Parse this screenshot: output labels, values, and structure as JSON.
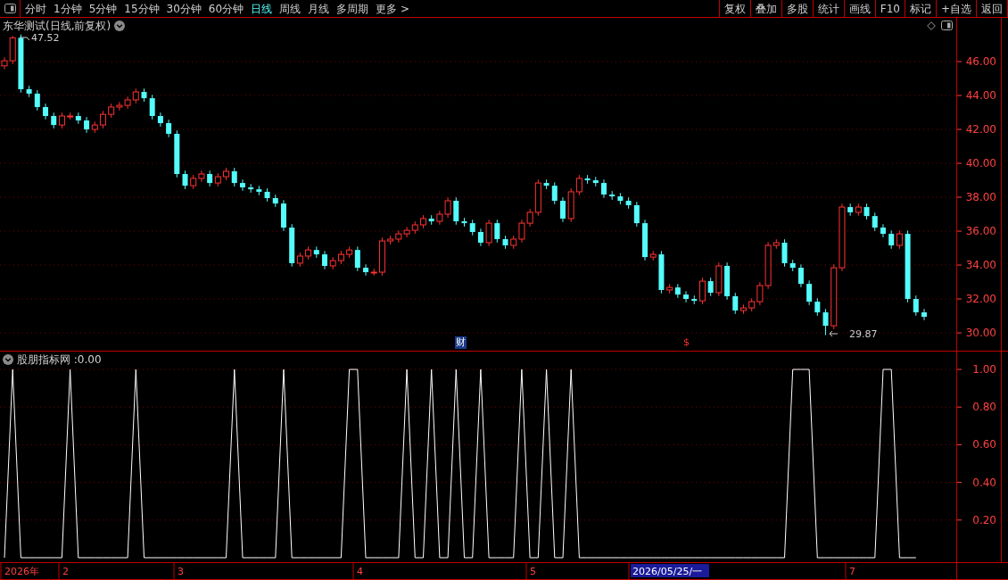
{
  "toolbar": {
    "tabs": [
      {
        "label": "分时",
        "selected": false
      },
      {
        "label": "1分钟",
        "selected": false
      },
      {
        "label": "5分钟",
        "selected": false
      },
      {
        "label": "15分钟",
        "selected": false
      },
      {
        "label": "30分钟",
        "selected": false
      },
      {
        "label": "60分钟",
        "selected": false
      },
      {
        "label": "日线",
        "selected": true
      },
      {
        "label": "周线",
        "selected": false
      },
      {
        "label": "月线",
        "selected": false
      },
      {
        "label": "多周期",
        "selected": false
      },
      {
        "label": "更多 >",
        "selected": false
      }
    ],
    "buttons": [
      "复权",
      "叠加",
      "多股",
      "统计",
      "画线",
      "F10",
      "标记",
      "+自选",
      "返回"
    ]
  },
  "price_pane": {
    "title": "东华测试(日线,前复权)",
    "chart_data": {
      "type": "candlestick",
      "grid": true,
      "ylim": [
        28.95,
        48.58
      ],
      "yticks": [
        {
          "value": 30,
          "label": "30.00"
        },
        {
          "value": 32,
          "label": "32.00"
        },
        {
          "value": 34,
          "label": "34.00"
        },
        {
          "value": 36,
          "label": "36.00"
        },
        {
          "value": 38,
          "label": "38.00"
        },
        {
          "value": 40,
          "label": "40.00"
        },
        {
          "value": 42,
          "label": "42.00"
        },
        {
          "value": 44,
          "label": "44.00"
        },
        {
          "value": 46,
          "label": "46.00"
        }
      ],
      "categories": [
        null,
        null,
        null,
        null,
        null,
        null,
        null,
        null,
        null,
        null,
        null,
        null,
        null,
        null,
        null,
        null,
        null,
        null,
        null,
        null,
        null,
        null,
        null,
        null,
        null,
        null,
        null,
        null,
        null,
        null,
        null,
        null,
        null,
        null,
        null,
        null,
        null,
        null,
        null,
        null,
        null,
        null,
        null,
        null,
        null,
        null,
        null,
        null,
        null,
        null,
        null,
        null,
        null,
        null,
        null,
        null,
        null,
        null,
        null,
        null,
        null,
        null,
        null,
        null,
        null,
        null,
        null,
        null,
        null,
        null,
        null,
        null,
        null,
        null,
        null,
        null,
        null,
        null,
        null,
        null,
        null,
        null,
        null,
        null,
        null,
        null,
        null,
        null,
        null,
        null,
        null,
        null,
        null,
        null,
        null,
        null,
        null,
        null,
        null,
        null,
        null,
        null,
        null,
        null,
        null,
        null,
        null,
        null,
        null,
        null,
        null,
        null,
        null
      ],
      "ohlc": [
        [
          45.75,
          46.25,
          45.55,
          46.05
        ],
        [
          46.05,
          47.52,
          45.85,
          47.4
        ],
        [
          47.4,
          47.6,
          44.17,
          44.37
        ],
        [
          44.37,
          44.57,
          43.91,
          44.11
        ],
        [
          44.11,
          44.31,
          43.12,
          43.32
        ],
        [
          43.32,
          43.52,
          42.59,
          42.79
        ],
        [
          42.79,
          42.99,
          42.06,
          42.26
        ],
        [
          42.26,
          42.99,
          42.06,
          42.79
        ],
        [
          42.79,
          42.99,
          42.59,
          42.79
        ],
        [
          42.79,
          42.99,
          42.33,
          42.53
        ],
        [
          42.53,
          42.73,
          41.8,
          42.0
        ],
        [
          42.0,
          42.46,
          41.8,
          42.26
        ],
        [
          42.26,
          43.09,
          42.06,
          42.89
        ],
        [
          42.89,
          43.52,
          42.69,
          43.32
        ],
        [
          43.32,
          43.62,
          43.12,
          43.42
        ],
        [
          43.42,
          43.94,
          43.22,
          43.74
        ],
        [
          43.74,
          44.41,
          43.54,
          44.21
        ],
        [
          44.21,
          44.41,
          43.64,
          43.84
        ],
        [
          43.84,
          44.04,
          42.59,
          42.79
        ],
        [
          42.79,
          42.99,
          42.17,
          42.37
        ],
        [
          42.37,
          42.57,
          41.54,
          41.74
        ],
        [
          41.74,
          41.94,
          39.17,
          39.37
        ],
        [
          39.37,
          39.57,
          38.48,
          38.68
        ],
        [
          38.68,
          39.31,
          38.48,
          39.11
        ],
        [
          39.11,
          39.57,
          38.91,
          39.37
        ],
        [
          39.37,
          39.57,
          38.64,
          38.84
        ],
        [
          38.84,
          39.41,
          38.64,
          39.21
        ],
        [
          39.21,
          39.73,
          39.01,
          39.53
        ],
        [
          39.53,
          39.73,
          38.64,
          38.84
        ],
        [
          38.84,
          39.04,
          38.38,
          38.58
        ],
        [
          38.58,
          38.78,
          38.27,
          38.47
        ],
        [
          38.47,
          38.67,
          38.12,
          38.32
        ],
        [
          38.32,
          38.52,
          37.75,
          37.95
        ],
        [
          37.95,
          38.15,
          37.43,
          37.63
        ],
        [
          37.63,
          37.83,
          36.01,
          36.21
        ],
        [
          36.21,
          36.41,
          33.91,
          34.11
        ],
        [
          34.11,
          34.73,
          33.91,
          34.53
        ],
        [
          34.53,
          35.09,
          34.33,
          34.89
        ],
        [
          34.89,
          35.09,
          34.43,
          34.63
        ],
        [
          34.63,
          34.83,
          33.75,
          33.95
        ],
        [
          33.95,
          34.46,
          33.75,
          34.26
        ],
        [
          34.26,
          34.83,
          34.06,
          34.63
        ],
        [
          34.63,
          35.09,
          34.43,
          34.89
        ],
        [
          34.89,
          35.09,
          33.64,
          33.84
        ],
        [
          33.84,
          34.04,
          33.38,
          33.58
        ],
        [
          33.58,
          33.78,
          33.38,
          33.58
        ],
        [
          33.58,
          35.62,
          33.38,
          35.42
        ],
        [
          35.42,
          35.73,
          35.22,
          35.53
        ],
        [
          35.53,
          36.04,
          35.33,
          35.84
        ],
        [
          35.84,
          36.25,
          35.64,
          36.05
        ],
        [
          36.05,
          36.57,
          35.85,
          36.37
        ],
        [
          36.37,
          36.94,
          36.17,
          36.74
        ],
        [
          36.74,
          36.94,
          36.38,
          36.58
        ],
        [
          36.58,
          37.2,
          36.38,
          37.0
        ],
        [
          37.0,
          37.99,
          36.8,
          37.79
        ],
        [
          37.79,
          37.99,
          36.38,
          36.58
        ],
        [
          36.58,
          36.78,
          36.27,
          36.47
        ],
        [
          36.47,
          36.67,
          35.75,
          35.95
        ],
        [
          35.95,
          36.15,
          35.12,
          35.32
        ],
        [
          35.32,
          36.67,
          35.12,
          36.47
        ],
        [
          36.47,
          36.67,
          35.33,
          35.53
        ],
        [
          35.53,
          35.73,
          34.96,
          35.16
        ],
        [
          35.16,
          35.73,
          34.96,
          35.53
        ],
        [
          35.53,
          36.67,
          35.33,
          36.47
        ],
        [
          36.47,
          37.31,
          36.27,
          37.11
        ],
        [
          37.11,
          39.04,
          36.91,
          38.84
        ],
        [
          38.84,
          39.04,
          38.48,
          38.68
        ],
        [
          38.68,
          38.88,
          37.59,
          37.79
        ],
        [
          37.79,
          37.99,
          36.54,
          36.74
        ],
        [
          36.74,
          38.52,
          36.54,
          38.32
        ],
        [
          38.32,
          39.31,
          38.12,
          39.11
        ],
        [
          39.11,
          39.31,
          38.8,
          39.0
        ],
        [
          39.0,
          39.2,
          38.64,
          38.84
        ],
        [
          38.84,
          39.04,
          37.96,
          38.16
        ],
        [
          38.16,
          38.36,
          37.85,
          38.05
        ],
        [
          38.05,
          38.25,
          37.59,
          37.79
        ],
        [
          37.79,
          37.99,
          37.33,
          37.53
        ],
        [
          37.53,
          37.73,
          36.27,
          36.47
        ],
        [
          36.47,
          36.67,
          34.27,
          34.47
        ],
        [
          34.47,
          34.83,
          34.27,
          34.63
        ],
        [
          34.63,
          34.83,
          32.33,
          32.53
        ],
        [
          32.53,
          32.88,
          32.33,
          32.68
        ],
        [
          32.68,
          32.88,
          32.06,
          32.26
        ],
        [
          32.26,
          32.46,
          31.8,
          32.0
        ],
        [
          32.0,
          32.2,
          31.69,
          31.89
        ],
        [
          31.89,
          33.25,
          31.69,
          33.05
        ],
        [
          33.05,
          33.25,
          32.17,
          32.37
        ],
        [
          32.37,
          34.15,
          32.17,
          33.95
        ],
        [
          33.95,
          34.15,
          31.96,
          32.16
        ],
        [
          32.16,
          32.36,
          31.12,
          31.32
        ],
        [
          31.32,
          31.67,
          31.12,
          31.47
        ],
        [
          31.47,
          32.04,
          31.27,
          31.84
        ],
        [
          31.84,
          32.99,
          31.64,
          32.79
        ],
        [
          32.79,
          35.36,
          32.59,
          35.16
        ],
        [
          35.16,
          35.52,
          34.96,
          35.32
        ],
        [
          35.32,
          35.52,
          33.91,
          34.11
        ],
        [
          34.11,
          34.31,
          33.64,
          33.84
        ],
        [
          33.84,
          34.04,
          32.69,
          32.89
        ],
        [
          32.89,
          33.09,
          31.64,
          31.84
        ],
        [
          31.84,
          32.04,
          31.01,
          31.21
        ],
        [
          31.21,
          31.41,
          29.87,
          30.42
        ],
        [
          30.42,
          34.04,
          30.22,
          33.84
        ],
        [
          33.84,
          37.62,
          33.64,
          37.42
        ],
        [
          37.42,
          37.62,
          36.91,
          37.11
        ],
        [
          37.11,
          37.62,
          36.91,
          37.42
        ],
        [
          37.42,
          37.62,
          36.69,
          36.89
        ],
        [
          36.89,
          37.09,
          36.01,
          36.21
        ],
        [
          36.21,
          36.41,
          35.64,
          35.84
        ],
        [
          35.84,
          36.04,
          34.96,
          35.16
        ],
        [
          35.16,
          36.04,
          34.96,
          35.84
        ],
        [
          35.84,
          36.04,
          31.8,
          32.0
        ],
        [
          32.0,
          32.2,
          31.01,
          31.21
        ],
        [
          31.21,
          31.41,
          30.75,
          30.95
        ]
      ],
      "annotations": [
        {
          "text": "47.52"
        },
        {
          "text": "29.87"
        }
      ]
    },
    "markers": [
      {
        "text": "财",
        "kind": "finance"
      },
      {
        "text": "$",
        "kind": "dividend"
      }
    ]
  },
  "indicator_pane": {
    "title": "股朋指标网 :0.00",
    "chart_data": {
      "type": "line",
      "grid": true,
      "ylim": [
        -0.114,
        1
      ],
      "yticks": [
        {
          "value": 0.2,
          "label": "0.20"
        },
        {
          "value": 0.4,
          "label": "0.40"
        },
        {
          "value": 0.6,
          "label": "0.60"
        },
        {
          "value": 0.8,
          "label": "0.80"
        },
        {
          "value": 1,
          "label": "1.00"
        }
      ],
      "categories": [
        null,
        null,
        null,
        null,
        null,
        null,
        null,
        null,
        null,
        null,
        null,
        null,
        null,
        null,
        null,
        null,
        null,
        null,
        null,
        null,
        null,
        null,
        null,
        null,
        null,
        null,
        null,
        null,
        null,
        null,
        null,
        null,
        null,
        null,
        null,
        null,
        null,
        null,
        null,
        null,
        null,
        null,
        null,
        null,
        null,
        null,
        null,
        null,
        null,
        null,
        null,
        null,
        null,
        null,
        null,
        null,
        null,
        null,
        null,
        null,
        null,
        null,
        null,
        null,
        null,
        null,
        null,
        null,
        null,
        null,
        null,
        null,
        null,
        null,
        null,
        null,
        null,
        null,
        null,
        null,
        null,
        null,
        null,
        null,
        null,
        null,
        null,
        null,
        null,
        null,
        null,
        null,
        null,
        null,
        null,
        null,
        null,
        null,
        null,
        null,
        null,
        null,
        null,
        null,
        null,
        null,
        null,
        null,
        null,
        null,
        null,
        null,
        null
      ],
      "series": [
        {
          "color": "#ffffff",
          "values": [
            0,
            1,
            0,
            0,
            0,
            0,
            0,
            0,
            1,
            0,
            0,
            0,
            0,
            0,
            0,
            0,
            1,
            0,
            0,
            0,
            0,
            0,
            0,
            0,
            0,
            0,
            0,
            0,
            1,
            0,
            0,
            0,
            0,
            0,
            1,
            0,
            0,
            0,
            0,
            0,
            0,
            0,
            1,
            1,
            0,
            0,
            0,
            0,
            0,
            1,
            0,
            0,
            1,
            0,
            0,
            1,
            0,
            0,
            1,
            0,
            0,
            0,
            0,
            1,
            0,
            0,
            1,
            0,
            0,
            1,
            0,
            0,
            0,
            0,
            0,
            0,
            0,
            0,
            0,
            0,
            0,
            0,
            0,
            0,
            0,
            0,
            0,
            0,
            0,
            0,
            0,
            0,
            0,
            0,
            0,
            0,
            1,
            1,
            1,
            0,
            0,
            0,
            0,
            0,
            0,
            0,
            0,
            1,
            1,
            0,
            0,
            0,
            null
          ]
        }
      ]
    }
  },
  "time_axis": {
    "labels": [
      {
        "text": "2026年",
        "selected": false
      },
      {
        "text": "2",
        "selected": false
      },
      {
        "text": "3",
        "selected": false
      },
      {
        "text": "4",
        "selected": false
      },
      {
        "text": "5",
        "selected": false
      },
      {
        "text": "2026/05/25/一",
        "selected": true
      },
      {
        "text": "7",
        "selected": false
      }
    ]
  }
}
